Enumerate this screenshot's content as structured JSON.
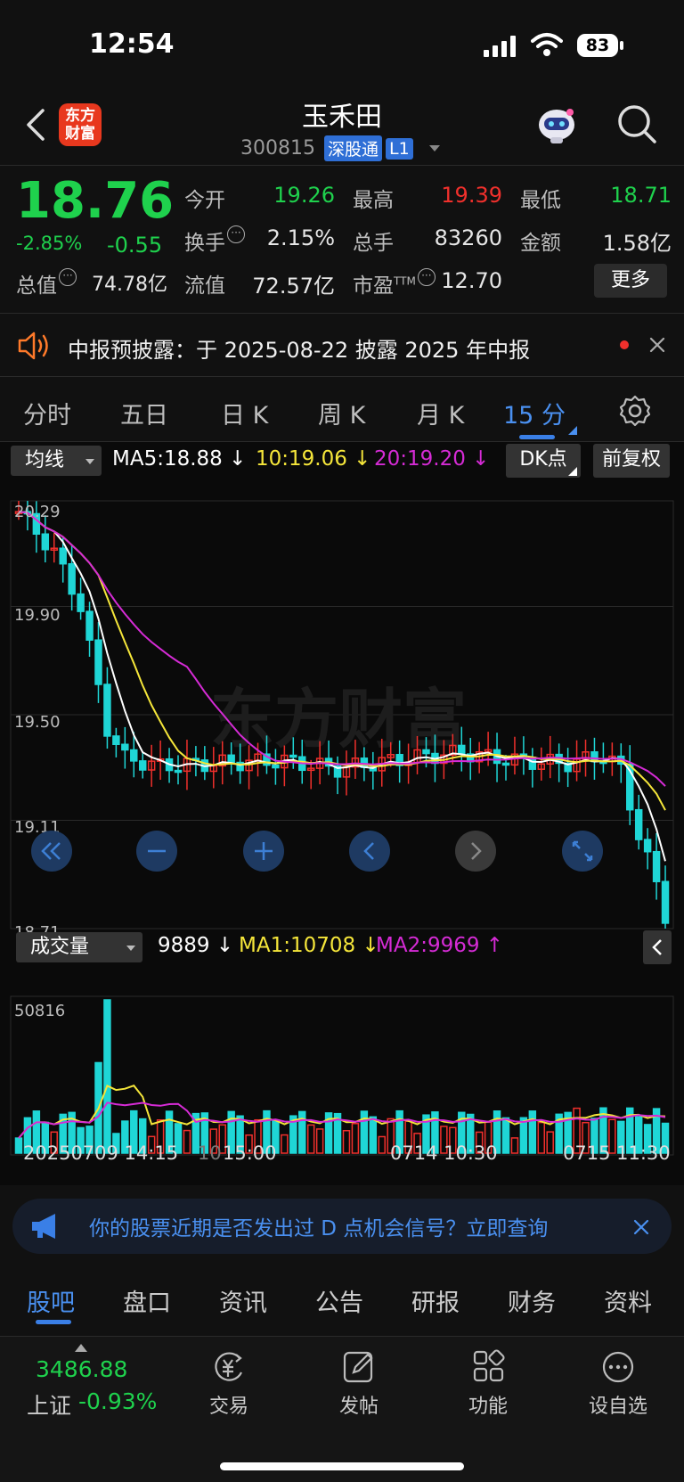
{
  "status_bar": {
    "time": "12:54",
    "battery": "83"
  },
  "header": {
    "logo_line1": "东方",
    "logo_line2": "财富",
    "stock_name": "玉禾田",
    "stock_code": "300815",
    "tag_market": "深股通",
    "tag_level": "L1"
  },
  "quote": {
    "price": "18.76",
    "change_pct": "-2.85%",
    "change": "-0.55",
    "fields": {
      "open_label": "今开",
      "open": "19.26",
      "high_label": "最高",
      "high": "19.39",
      "low_label": "最低",
      "low": "18.71",
      "turnover_label": "换手",
      "turnover": "2.15%",
      "volume_label": "总手",
      "volume": "83260",
      "amount_label": "金额",
      "amount": "1.58亿",
      "mktcap_label": "总值",
      "mktcap": "74.78亿",
      "float_label": "流值",
      "float": "72.57亿",
      "pe_label": "市盈",
      "pe_sup": "TTM",
      "pe": "12.70"
    },
    "more_label": "更多"
  },
  "notice": {
    "text": "中报预披露：于 2025-08-22 披露 2025 年中报"
  },
  "period_tabs": [
    "分时",
    "五日",
    "日 K",
    "周 K",
    "月 K",
    "15 分"
  ],
  "active_period": "15 分",
  "kline": {
    "indicator_select": "均线",
    "ma5": "MA5:18.88",
    "ma10": "10:19.06",
    "ma20": "20:19.20",
    "dk_label": "DK点",
    "adjust_label": "前复权",
    "price_ticks": [
      "20.29",
      "19.90",
      "19.50",
      "19.11",
      "18.71"
    ],
    "watermark": "东方财富"
  },
  "volume": {
    "indicator_select": "成交量",
    "vol": "9889",
    "ma1": "MA1:10708",
    "ma2": "MA2:9969",
    "max_tick": "50816",
    "date_labels": [
      "20250709 14:15",
      "10",
      "15:00",
      "0714 10:30",
      "0715 11:30"
    ]
  },
  "chart_data": {
    "type": "candlestick",
    "interval": "15 分",
    "ylim": [
      18.71,
      20.29
    ],
    "last_close": 18.76,
    "high": 20.29,
    "low": 18.71,
    "ma5_last": 18.88,
    "ma10_last": 19.06,
    "ma20_last": 19.2,
    "volume_max": 50816,
    "volume_last": 9889,
    "vol_ma1_last": 10708,
    "vol_ma2_last": 9969,
    "colors": {
      "up": "#f0302c",
      "down": "#1fd6d6",
      "ma5": "#ffffff",
      "ma10": "#f5e63a",
      "ma20": "#d52bd5"
    }
  },
  "ad": {
    "text": "你的股票近期是否发出过 D 点机会信号？立即查询"
  },
  "content_tabs": [
    "股吧",
    "盘口",
    "资讯",
    "公告",
    "研报",
    "财务",
    "资料"
  ],
  "bottom_bar": {
    "index_value": "3486.88",
    "index_name": "上证",
    "index_change": "-0.93%",
    "items": [
      "交易",
      "发帖",
      "功能",
      "设自选"
    ]
  }
}
